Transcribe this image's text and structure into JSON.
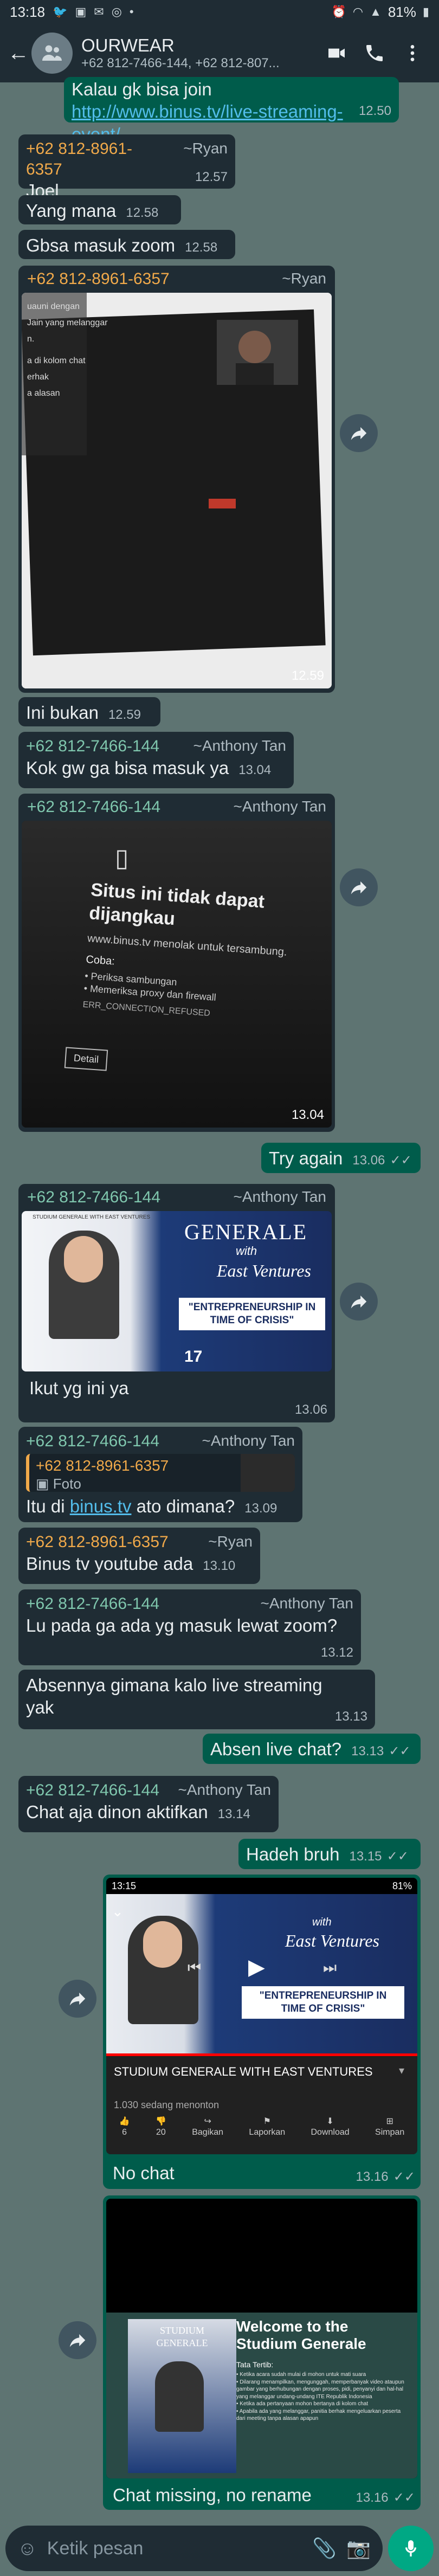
{
  "status": {
    "time": "13:18",
    "battery": "81%"
  },
  "header": {
    "name": "OURWEAR",
    "members": "+62 812-7466-144, +62 812-807..."
  },
  "messages": {
    "m0": {
      "text_a": "Kalau gk bisa join ",
      "link": "http://www.binus.tv/live-streaming-event/",
      "time": "12.50"
    },
    "m1": {
      "sender": "+62 812-8961-6357",
      "alias": "~Ryan",
      "text": "Joel",
      "time": "12.57"
    },
    "m2": {
      "text": "Yang mana",
      "time": "12.58"
    },
    "m3": {
      "text": "Gbsa masuk zoom",
      "time": "12.58"
    },
    "m4": {
      "sender": "+62 812-8961-6357",
      "alias": "~Ryan",
      "time": "12.59"
    },
    "m5": {
      "text": "Ini bukan",
      "time": "12.59"
    },
    "m6": {
      "sender": "+62 812-7466-144",
      "alias": "~Anthony Tan",
      "text": "Kok gw ga bisa masuk ya",
      "time": "13.04"
    },
    "m7": {
      "sender": "+62 812-7466-144",
      "alias": "~Anthony Tan",
      "time": "13.04",
      "error_title": "Situs ini tidak dapat dijangkau",
      "error_sub": "www.binus.tv menolak untuk tersambung.",
      "error_coba": "Coba:",
      "error_b1": "Periksa sambungan",
      "error_b2": "Memeriksa proxy dan firewall",
      "error_code": "ERR_CONNECTION_REFUSED",
      "error_btn": "Detail"
    },
    "m8": {
      "text": "Try again",
      "time": "13.06"
    },
    "m9": {
      "sender": "+62 812-7466-144",
      "alias": "~Anthony Tan",
      "time": "13.06",
      "text": "Ikut yg ini ya",
      "img_top": "STUDIUM GENERALE WITH EAST VENTURES",
      "img_generale": "GENERALE",
      "img_with": "with",
      "img_brand": "East Ventures",
      "img_banner": "\"ENTREPRENEURSHIP IN TIME OF CRISIS\""
    },
    "m10": {
      "sender": "+62 812-7466-144",
      "alias": "~Anthony Tan",
      "quote_sender": "+62 812-8961-6357",
      "quote_text": "Foto",
      "text_a": "Itu di ",
      "link": "binus.tv",
      "text_b": " ato dimana?",
      "time": "13.09"
    },
    "m11": {
      "sender": "+62 812-8961-6357",
      "alias": "~Ryan",
      "text": "Binus tv youtube ada",
      "time": "13.10"
    },
    "m12": {
      "sender": "+62 812-7466-144",
      "alias": "~Anthony Tan",
      "text": "Lu pada ga ada yg masuk lewat zoom?",
      "time": "13.12"
    },
    "m13": {
      "text": "Absennya gimana kalo live streaming yak",
      "time": "13.13"
    },
    "m14": {
      "text": "Absen live chat?",
      "time": "13.13"
    },
    "m15": {
      "sender": "+62 812-7466-144",
      "alias": "~Anthony Tan",
      "text": "Chat aja dinon aktifkan",
      "time": "13.14"
    },
    "m16": {
      "text": "Hadeh bruh",
      "time": "13.15"
    },
    "m17": {
      "text": "No chat",
      "time": "13.16",
      "ss_time": "13:15",
      "ss_batt": "81%",
      "yt_title": "STUDIUM GENERALE WITH EAST VENTURES",
      "yt_watching": "1.030 sedang menonton",
      "yt_likes": "6",
      "yt_dislikes": "20",
      "yt_share": "Bagikan",
      "yt_report": "Laporkan",
      "yt_download": "Download",
      "yt_save": "Simpan",
      "img_banner": "\"ENTREPRENEURSHIP IN TIME OF CRISIS\"",
      "img_brand": "East Ventures",
      "img_with": "with"
    },
    "m18": {
      "text": "Chat missing, no rename",
      "time": "13.16",
      "welcome": "Welcome to the Studium Generale",
      "rules": "Tata Tertib:",
      "r1": "Ketika acara sudah mulai di mohon untuk mati suara",
      "r2": "Dilarang menampilkan, mengunggah, memperbanyak video ataupun gambar yang berhubungan dengan proses, pidi, penyanyi dan hal-hal yang melanggar undang-undang ITE Republik Indonesia",
      "r3": "Ketika ada pertanyaan mohon bertanya di kolom chat",
      "r4": "Apabila ada yang melanggar, panitia berhak mengeluarkan peserta dari meeting tanpa alasan apapun",
      "poster_title": "STUDIUM GENERALE"
    }
  },
  "input": {
    "placeholder": "Ketik pesan"
  },
  "colors": {
    "header": "#1f2c34",
    "bubble_in": "#1f2c34",
    "bubble_out": "#005c4b",
    "wallpaper": "#5e7472",
    "ryan": "#f0a94a",
    "anthony": "#7fc6ad",
    "link": "#53bdeb",
    "accent": "#00a884"
  }
}
